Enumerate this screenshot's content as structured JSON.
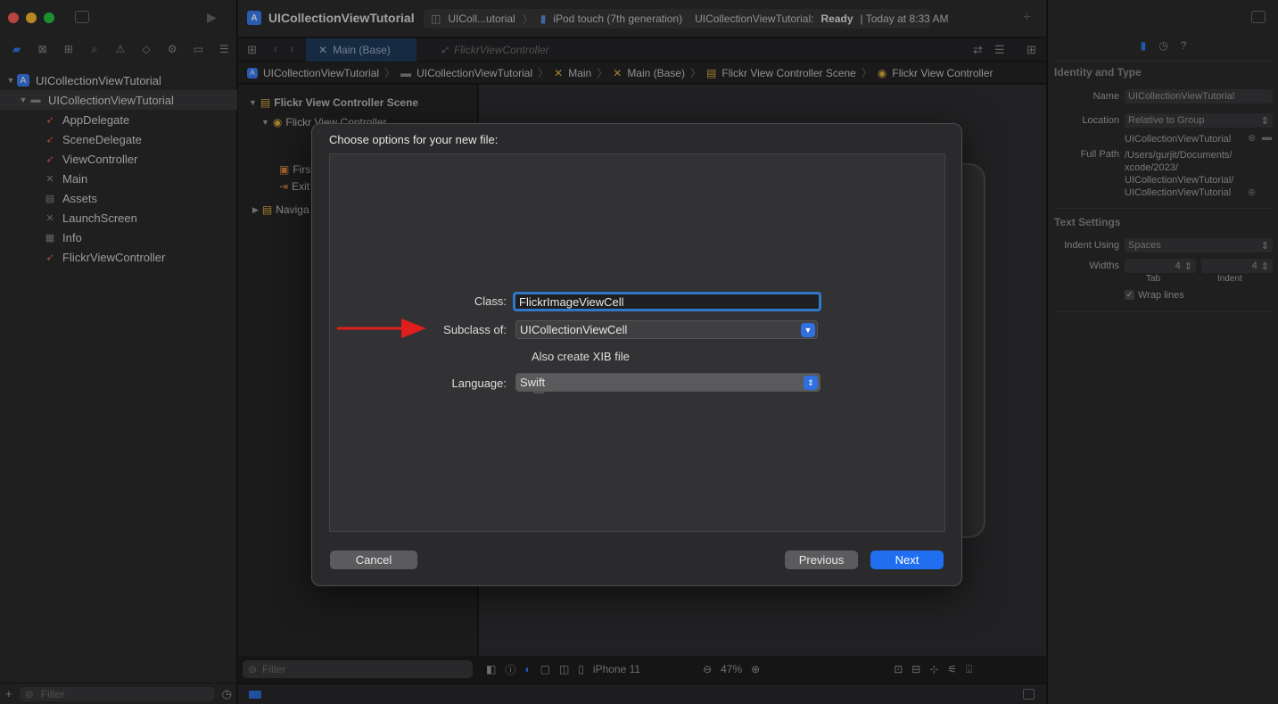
{
  "window": {
    "project_title": "UICollectionViewTutorial",
    "scheme_target": "UIColl...utorial",
    "device": "iPod touch (7th generation)",
    "status_prefix": "UICollectionViewTutorial:",
    "status_state": "Ready",
    "status_time": "| Today at 8:33 AM"
  },
  "navigator": {
    "items": [
      {
        "label": "UICollectionViewTutorial",
        "icon": "project-icon"
      },
      {
        "label": "UICollectionViewTutorial",
        "icon": "folder-icon"
      },
      {
        "label": "AppDelegate",
        "icon": "swift-file-icon"
      },
      {
        "label": "SceneDelegate",
        "icon": "swift-file-icon"
      },
      {
        "label": "ViewController",
        "icon": "swift-file-icon"
      },
      {
        "label": "Main",
        "icon": "storyboard-icon"
      },
      {
        "label": "Assets",
        "icon": "assets-icon"
      },
      {
        "label": "LaunchScreen",
        "icon": "storyboard-icon"
      },
      {
        "label": "Info",
        "icon": "plist-icon"
      },
      {
        "label": "FlickrViewController",
        "icon": "swift-file-icon"
      }
    ],
    "filter_placeholder": "Filter"
  },
  "editor": {
    "tabs": [
      {
        "label": "Main (Base)",
        "active": true
      },
      {
        "label": "FlickrViewController",
        "active": false
      }
    ],
    "jumpbar": [
      "UICollectionViewTutorial",
      "UICollectionViewTutorial",
      "Main",
      "Main (Base)",
      "Flickr View Controller Scene",
      "Flickr View Controller"
    ],
    "outline": {
      "scene": "Flickr View Controller Scene",
      "controller": "Flickr View Controller",
      "first_responder": "Firs",
      "exit": "Exit",
      "navigation": "Naviga"
    },
    "outline_filter_placeholder": "Filter",
    "canvas_device": "iPhone 11",
    "zoom": "47%"
  },
  "inspector": {
    "identity_title": "Identity and Type",
    "name_label": "Name",
    "name_value": "UICollectionViewTutorial",
    "location_label": "Location",
    "location_value": "Relative to Group",
    "location_path": "UICollectionViewTutorial",
    "full_path_label": "Full Path",
    "full_path_lines": [
      "/Users/gurjit/Documents/",
      "xcode/2023/",
      "UICollectionViewTutorial/",
      "UICollectionViewTutorial"
    ],
    "text_settings_title": "Text Settings",
    "indent_label": "Indent Using",
    "indent_value": "Spaces",
    "widths_label": "Widths",
    "tab_value": "4",
    "indent_width_value": "4",
    "tab_caption": "Tab",
    "indent_caption": "Indent",
    "wrap_lines": "Wrap lines"
  },
  "dialog": {
    "title": "Choose options for your new file:",
    "class_label": "Class:",
    "class_value": "FlickrImageViewCell",
    "subclass_label": "Subclass of:",
    "subclass_value": "UICollectionViewCell",
    "xib_label": "Also create XIB file",
    "xib_checked": false,
    "language_label": "Language:",
    "language_value": "Swift",
    "cancel": "Cancel",
    "previous": "Previous",
    "next": "Next"
  },
  "colors": {
    "accent": "#1f6ff0",
    "annotation_arrow": "#e01e1e"
  }
}
